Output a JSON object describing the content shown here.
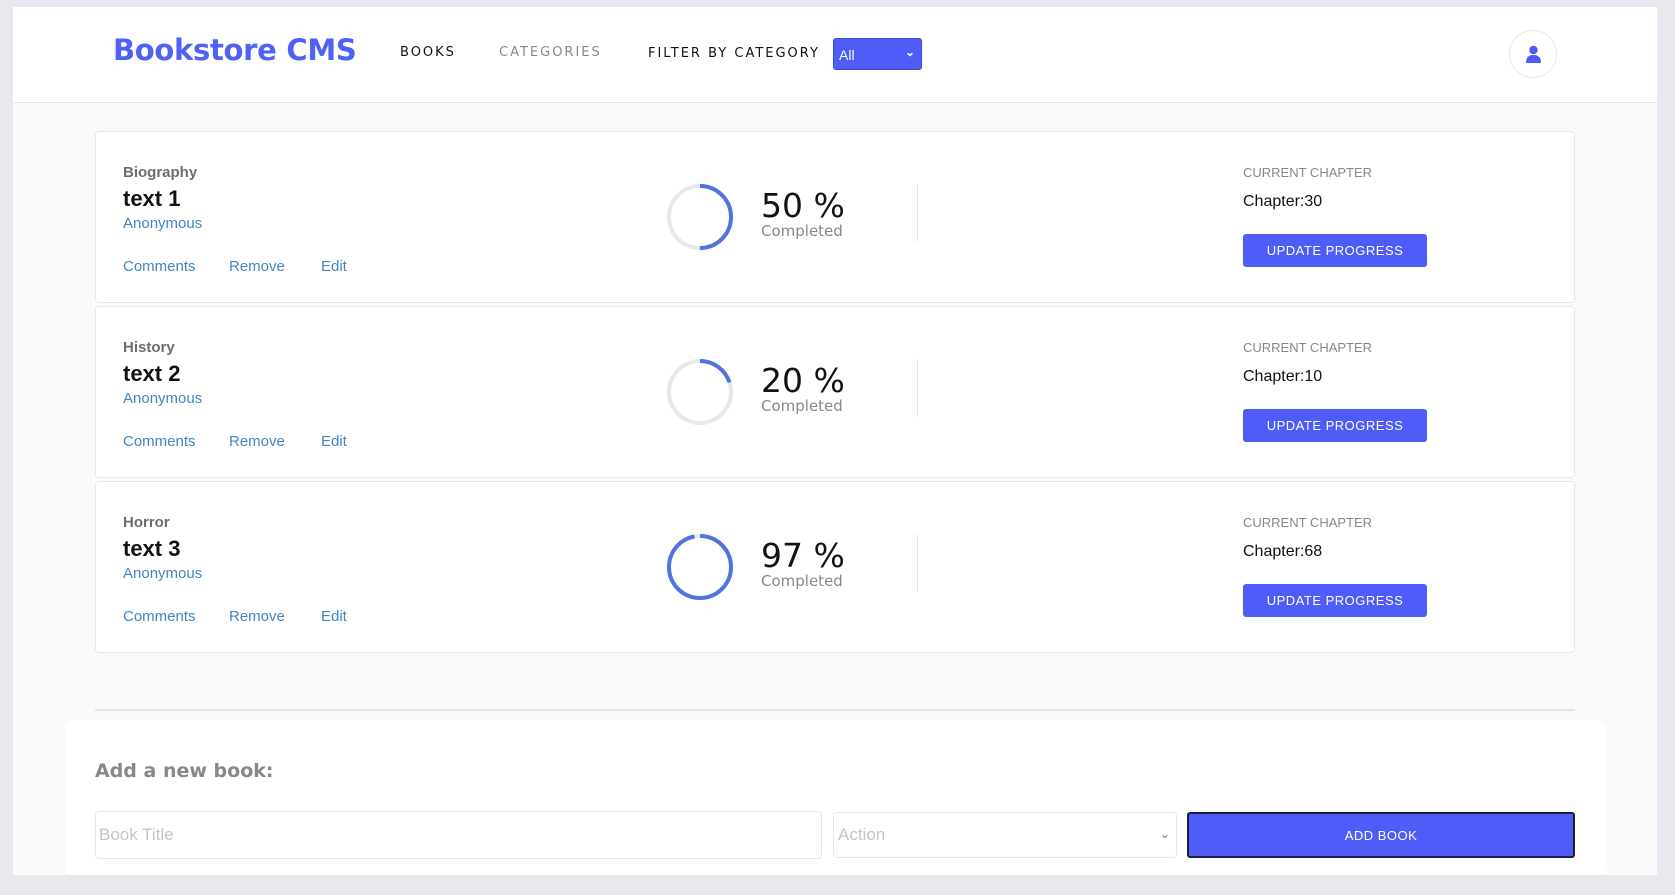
{
  "header": {
    "brand": "Bookstore CMS",
    "nav": {
      "books": "BOOKS",
      "categories": "CATEGORIES"
    },
    "filter": {
      "label": "FILTER BY CATEGORY",
      "selected": "All"
    },
    "avatar_icon": "user-icon"
  },
  "books": [
    {
      "category": "Biography",
      "title": "text 1",
      "author": "Anonymous",
      "actions": {
        "comments": "Comments",
        "remove": "Remove",
        "edit": "Edit"
      },
      "percent": 50,
      "percent_text": "50 %",
      "completed_label": "Completed",
      "current_chapter_label": "CURRENT CHAPTER",
      "chapter": "Chapter:30",
      "update_button": "UPDATE PROGRESS"
    },
    {
      "category": "History",
      "title": "text 2",
      "author": "Anonymous",
      "actions": {
        "comments": "Comments",
        "remove": "Remove",
        "edit": "Edit"
      },
      "percent": 20,
      "percent_text": "20 %",
      "completed_label": "Completed",
      "current_chapter_label": "CURRENT CHAPTER",
      "chapter": "Chapter:10",
      "update_button": "UPDATE PROGRESS"
    },
    {
      "category": "Horror",
      "title": "text 3",
      "author": "Anonymous",
      "actions": {
        "comments": "Comments",
        "remove": "Remove",
        "edit": "Edit"
      },
      "percent": 97,
      "percent_text": "97 %",
      "completed_label": "Completed",
      "current_chapter_label": "CURRENT CHAPTER",
      "chapter": "Chapter:68",
      "update_button": "UPDATE PROGRESS"
    }
  ],
  "add_book": {
    "title": "Add a new book:",
    "title_placeholder": "Book Title",
    "category_placeholder": "Action",
    "submit": "ADD BOOK"
  },
  "colors": {
    "accent": "#4f5cf8",
    "link": "#4386bf",
    "ring_progress": "#4f73e3",
    "ring_track": "#e8e8e8"
  }
}
